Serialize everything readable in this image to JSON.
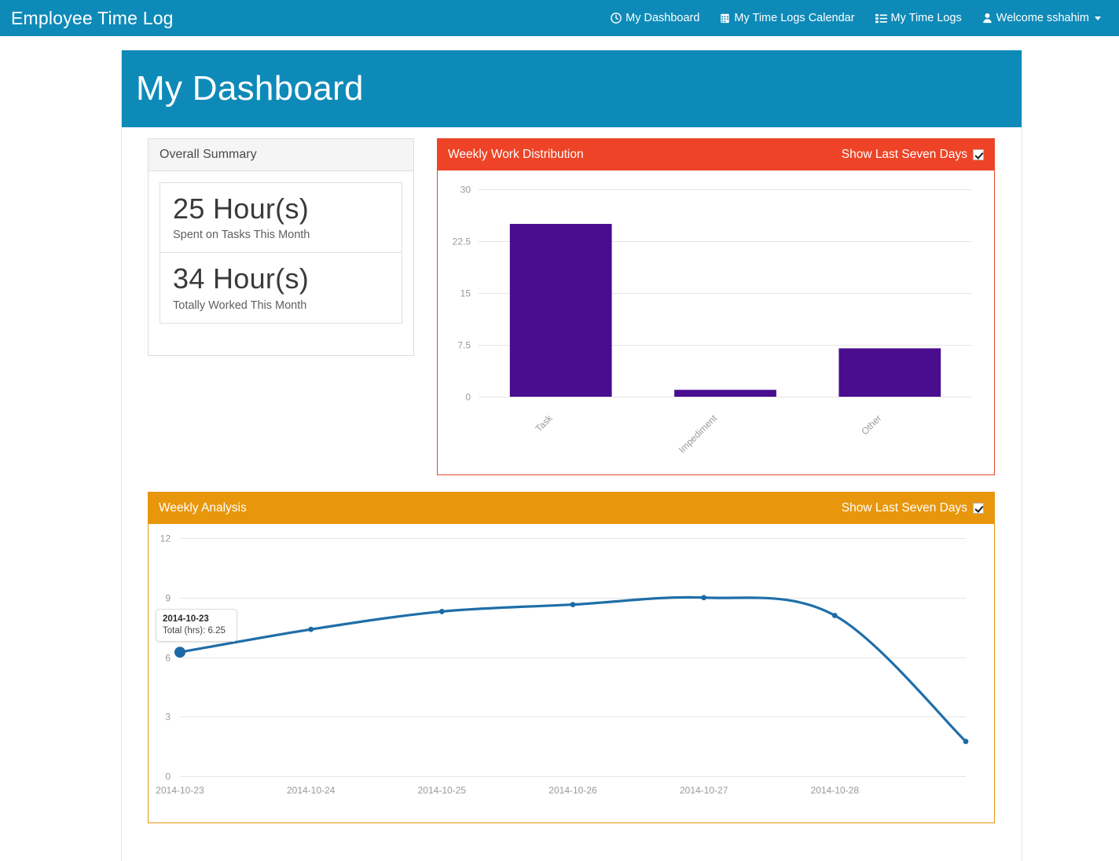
{
  "navbar": {
    "brand": "Employee Time Log",
    "links": [
      {
        "label": "My Dashboard",
        "icon": "clock-icon"
      },
      {
        "label": "My Time Logs Calendar",
        "icon": "calendar-icon"
      },
      {
        "label": "My Time Logs",
        "icon": "list-icon"
      },
      {
        "label": "Welcome sshahim",
        "icon": "user-icon"
      }
    ]
  },
  "jumbotron": {
    "title": "My Dashboard"
  },
  "summary": {
    "heading": "Overall Summary",
    "items": [
      {
        "value": "25 Hour(s)",
        "label": "Spent on Tasks This Month"
      },
      {
        "value": "34 Hour(s)",
        "label": "Totally Worked This Month"
      }
    ]
  },
  "weekly_work_distribution": {
    "heading": "Weekly Work Distribution",
    "toggle_label": "Show Last Seven Days",
    "toggle_checked": true,
    "header_color": "#ee4326"
  },
  "weekly_analysis": {
    "heading": "Weekly Analysis",
    "toggle_label": "Show Last Seven Days",
    "toggle_checked": true,
    "header_color": "#e8960c",
    "tooltip": {
      "date": "2014-10-23",
      "total": "Total (hrs): 6.25"
    }
  },
  "chart_data": [
    {
      "type": "bar",
      "title": "Weekly Work Distribution",
      "categories": [
        "Task",
        "Impediment",
        "Other"
      ],
      "values": [
        25,
        1,
        7
      ],
      "xlabel": "",
      "ylabel": "",
      "ylim": [
        0,
        30
      ],
      "yticks": [
        0,
        7.5,
        15,
        22.5,
        30
      ],
      "ytick_labels": [
        "0",
        "7.5",
        "15",
        "22.5",
        "30"
      ],
      "grid": true,
      "bar_color": "#4a0d8f",
      "legend": "none",
      "xtick_rotation": -45
    },
    {
      "type": "line",
      "title": "Weekly Analysis",
      "x": [
        "2014-10-23",
        "2014-10-24",
        "2014-10-25",
        "2014-10-26",
        "2014-10-27",
        "2014-10-28",
        "2014-10-29"
      ],
      "series": [
        {
          "name": "Total (hrs)",
          "values": [
            6.25,
            7.4,
            8.3,
            8.65,
            9.0,
            8.1,
            1.75
          ]
        }
      ],
      "xlabel": "",
      "ylabel": "",
      "ylim": [
        0,
        12
      ],
      "yticks": [
        0,
        3,
        6,
        9,
        12
      ],
      "ytick_labels": [
        "0",
        "3",
        "6",
        "9",
        "12"
      ],
      "xtick_labels": [
        "2014-10-23",
        "2014-10-24",
        "2014-10-25",
        "2014-10-26",
        "2014-10-27",
        "2014-10-28"
      ],
      "grid": true,
      "line_color": "#1f6ea8",
      "point_color": "#1b6aa5",
      "legend": "none",
      "annotation": {
        "at": "2014-10-23",
        "date": "2014-10-23",
        "text": "Total (hrs): 6.25"
      }
    }
  ]
}
